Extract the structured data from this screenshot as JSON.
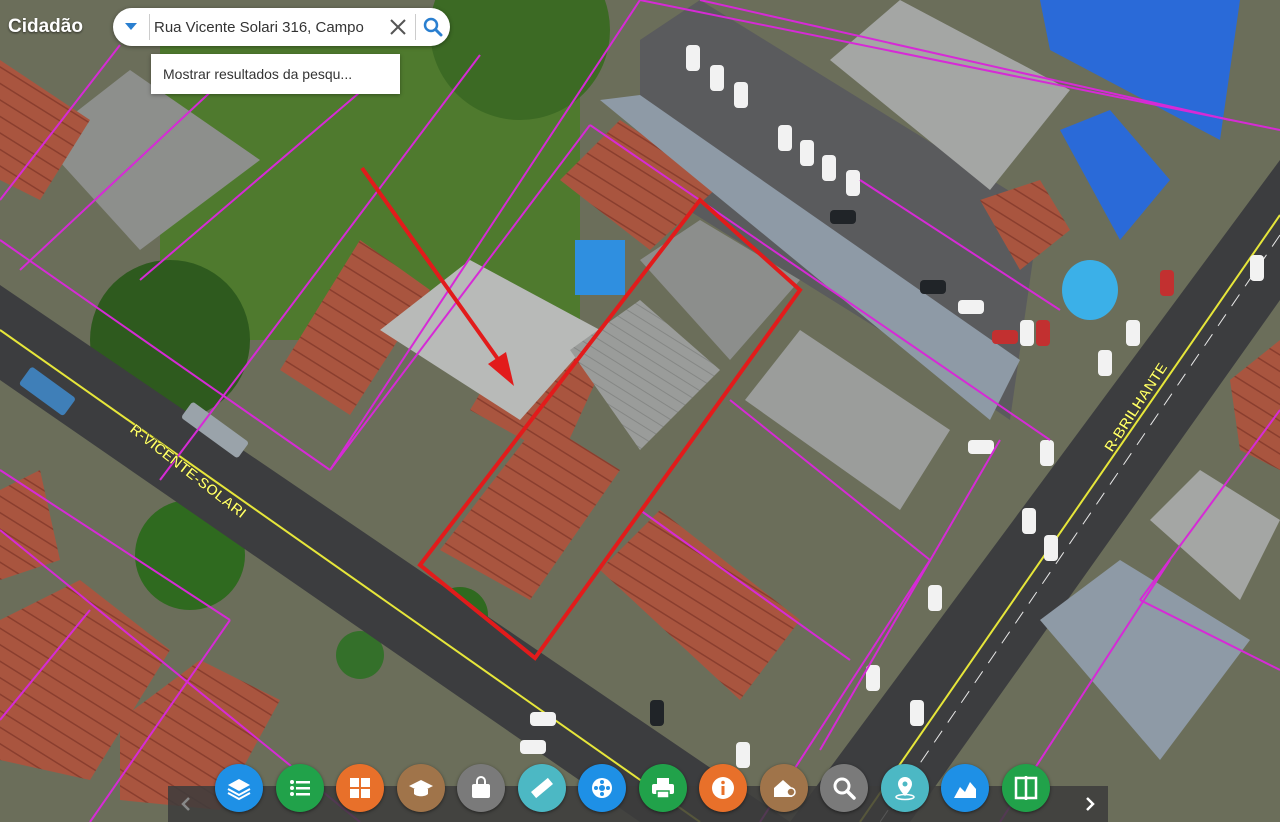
{
  "app": {
    "brand": "Cidadão"
  },
  "search": {
    "value": "Rua Vicente Solari 316, Campo",
    "suggestion": "Mostrar resultados da pesqu..."
  },
  "map": {
    "street_labels": [
      "R-VICENTE-SOLARI",
      "R-BRILHANTE"
    ],
    "colors": {
      "lot_lines": "#d62ad6",
      "street_axis": "#e6e63a",
      "highlight": "#e21b1b"
    }
  },
  "toolbar": {
    "prev_icon": "chevron-left-icon",
    "next_icon": "chevron-right-icon",
    "tools": [
      {
        "name": "layers-tool",
        "icon": "layers-icon",
        "color": "#1e90e6"
      },
      {
        "name": "legend-tool",
        "icon": "list-icon",
        "color": "#21a24a"
      },
      {
        "name": "grid-tool",
        "icon": "grid-icon",
        "color": "#e8702a"
      },
      {
        "name": "education-tool",
        "icon": "graduation-cap-icon",
        "color": "#a0744a"
      },
      {
        "name": "bag-tool",
        "icon": "bag-icon",
        "color": "#7a7a7a"
      },
      {
        "name": "measure-tool",
        "icon": "ruler-icon",
        "color": "#4cb8c4"
      },
      {
        "name": "street-view-tool",
        "icon": "camera-reel-icon",
        "color": "#1e90e6"
      },
      {
        "name": "print-tool",
        "icon": "printer-icon",
        "color": "#21a24a"
      },
      {
        "name": "info-tool",
        "icon": "info-icon",
        "color": "#e8702a"
      },
      {
        "name": "property-tool",
        "icon": "house-pin-icon",
        "color": "#a0744a"
      },
      {
        "name": "search-zoom-tool",
        "icon": "magnifier-icon",
        "color": "#7a7a7a"
      },
      {
        "name": "location-tool",
        "icon": "location-icon",
        "color": "#4cb8c4"
      },
      {
        "name": "elevation-tool",
        "icon": "chart-area-icon",
        "color": "#1e90e6"
      },
      {
        "name": "compare-tool",
        "icon": "split-view-icon",
        "color": "#21a24a"
      }
    ]
  }
}
